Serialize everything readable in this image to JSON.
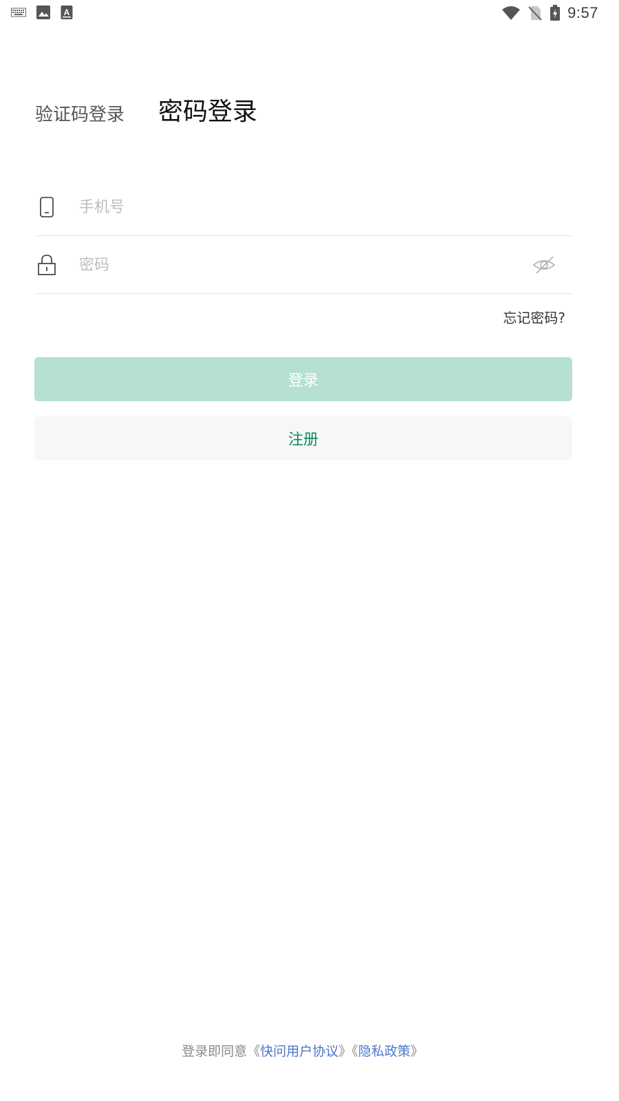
{
  "status_bar": {
    "time": "9:57",
    "icons": [
      "keyboard-icon",
      "image-icon",
      "font-icon",
      "wifi-icon",
      "no-sim-icon",
      "battery-charging-icon"
    ]
  },
  "tabs": {
    "sms_login": "验证码登录",
    "password_login": "密码登录",
    "active": "password_login"
  },
  "form": {
    "phone_placeholder": "手机号",
    "phone_value": "",
    "password_placeholder": "密码",
    "password_value": "",
    "forgot_password": "忘记密码?"
  },
  "buttons": {
    "login": "登录",
    "register": "注册"
  },
  "agreement": {
    "prefix": "登录即同意",
    "open1": "《",
    "user_agreement": "快问用户协议",
    "close1": "》",
    "open2": "《",
    "privacy_policy": "隐私政策",
    "close2": "》"
  },
  "colors": {
    "login_button_bg": "#b5e0d3",
    "register_text": "#0e8a5f",
    "link": "#4a78c8"
  }
}
